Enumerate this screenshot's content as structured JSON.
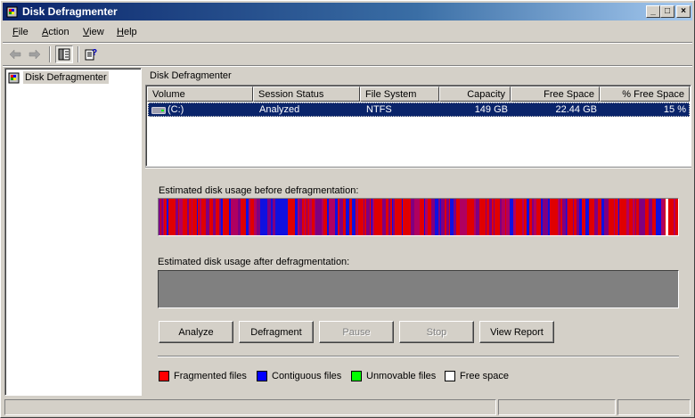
{
  "window": {
    "title": "Disk Defragmenter",
    "controls": {
      "minimize": "_",
      "maximize": "□",
      "close": "×"
    }
  },
  "menu": [
    {
      "label": "File",
      "accel": "F",
      "rest": "ile"
    },
    {
      "label": "Action",
      "accel": "A",
      "rest": "ction"
    },
    {
      "label": "View",
      "accel": "V",
      "rest": "iew"
    },
    {
      "label": "Help",
      "accel": "H",
      "rest": "elp"
    }
  ],
  "toolbar": {
    "back_icon": "back-arrow-icon",
    "forward_icon": "forward-arrow-icon",
    "tree_toggle_icon": "show-hide-tree-icon",
    "help_icon": "help-icon"
  },
  "tree": {
    "root_label": "Disk Defragmenter"
  },
  "pane": {
    "header": "Disk Defragmenter"
  },
  "volumes_table": {
    "columns": [
      "Volume",
      "Session Status",
      "File System",
      "Capacity",
      "Free Space",
      "% Free Space"
    ],
    "rows": [
      {
        "volume": "(C:)",
        "status": "Analyzed",
        "file_system": "NTFS",
        "capacity": "149 GB",
        "free_space": "22.44 GB",
        "pct_free": "15 %"
      }
    ]
  },
  "display": {
    "before_label": "Estimated disk usage before defragmentation:",
    "after_label": "Estimated disk usage after defragmentation:"
  },
  "buttons": {
    "analyze": "Analyze",
    "defragment": "Defragment",
    "pause": "Pause",
    "stop": "Stop",
    "view_report": "View Report"
  },
  "legend": [
    {
      "label": "Fragmented files",
      "color": "#ff0000"
    },
    {
      "label": "Contiguous files",
      "color": "#0000ff"
    },
    {
      "label": "Unmovable files",
      "color": "#00ff00"
    },
    {
      "label": "Free space",
      "color": "#ffffff"
    }
  ],
  "colors": {
    "fragmented": "#e00000",
    "contiguous": "#1010e0",
    "mixed": "#800080",
    "selection": "#0a246a"
  }
}
